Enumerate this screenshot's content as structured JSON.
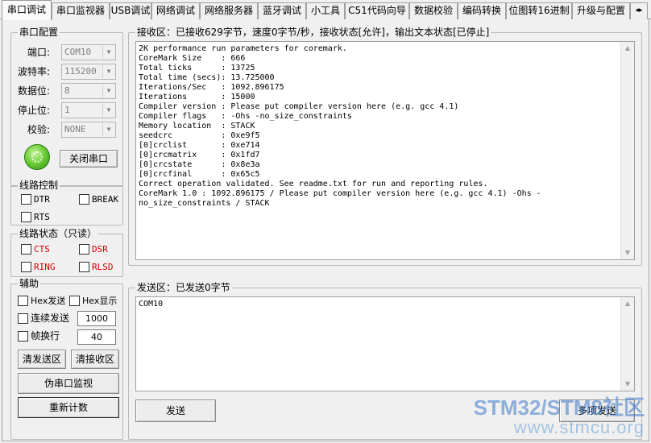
{
  "tabs": [
    {
      "label": "串口调试",
      "active": true
    },
    {
      "label": "串口监视器"
    },
    {
      "label": "USB调试"
    },
    {
      "label": "网络调试"
    },
    {
      "label": "网络服务器"
    },
    {
      "label": "蓝牙调试"
    },
    {
      "label": "小工具"
    },
    {
      "label": "C51代码向导"
    },
    {
      "label": "数据校验"
    },
    {
      "label": "编码转换"
    },
    {
      "label": "位图转16进制"
    },
    {
      "label": "升级与配置"
    }
  ],
  "serial_config": {
    "title": "串口配置",
    "port_label": "端口:",
    "port_value": "COM10",
    "baud_label": "波特率:",
    "baud_value": "115200",
    "databits_label": "数据位:",
    "databits_value": "8",
    "stopbits_label": "停止位:",
    "stopbits_value": "1",
    "parity_label": "校验:",
    "parity_value": "NONE",
    "close_button": "关闭串口",
    "led_icon": "led-green-icon"
  },
  "line_control": {
    "title": "线路控制",
    "dtr": "DTR",
    "break": "BREAK",
    "rts": "RTS"
  },
  "line_status": {
    "title": "线路状态（只读）",
    "cts": "CTS",
    "dsr": "DSR",
    "ring": "RING",
    "rlsd": "RLSD",
    "status_color": "#d40000"
  },
  "assist": {
    "title": "辅助",
    "hex_send": "Hex发送",
    "hex_display": "Hex显示",
    "continuous_send": "连续发送",
    "continuous_interval": "1000",
    "frame_newline": "帧换行",
    "frame_value": "40",
    "clear_send_button": "清发送区",
    "clear_recv_button": "清接收区",
    "fake_monitor_button": "伪串口监视",
    "recount_button": "重新计数"
  },
  "receive": {
    "title": "接收区：已接收629字节，速度0字节/秒，接收状态[允许]，输出文本状态[已停止]",
    "lines": [
      "2K performance run parameters for coremark.",
      "CoreMark Size    : 666",
      "Total ticks      : 13725",
      "Total time (secs): 13.725000",
      "Iterations/Sec   : 1092.896175",
      "Iterations       : 15000",
      "Compiler version : Please put compiler version here (e.g. gcc 4.1)",
      "Compiler flags   : -Ohs -no_size_constraints",
      "Memory location  : STACK",
      "seedcrc          : 0xe9f5",
      "[0]crclist       : 0xe714",
      "[0]crcmatrix     : 0x1fd7",
      "[0]crcstate      : 0x8e3a",
      "[0]crcfinal      : 0x65c5",
      "Correct operation validated. See readme.txt for run and reporting rules.",
      "CoreMark 1.0 : 1092.896175 / Please put compiler version here (e.g. gcc 4.1) -Ohs -",
      "no_size_constraints / STACK"
    ]
  },
  "send": {
    "title": "发送区：已发送0字节",
    "text": "COM10",
    "send_button": "发送",
    "multi_send_button": "多项发送"
  },
  "watermark": {
    "top": "STM32/STM8社区",
    "bottom": "www.stmcu.org"
  }
}
